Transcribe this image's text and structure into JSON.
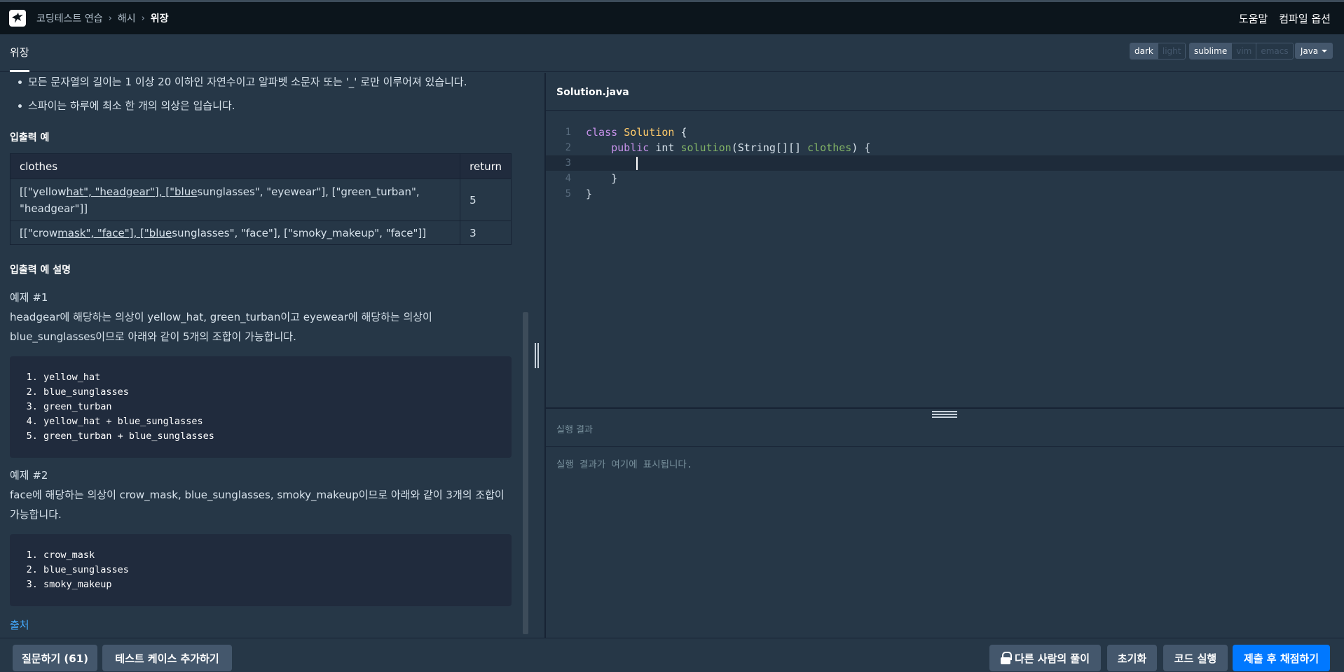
{
  "header": {
    "breadcrumbs": [
      "코딩테스트 연습",
      "해시",
      "위장"
    ],
    "help_label": "도움말",
    "compile_options_label": "컴파일 옵션"
  },
  "subbar": {
    "problem_title": "위장",
    "theme_options": [
      "dark",
      "light"
    ],
    "theme_selected": "dark",
    "keymap_options": [
      "sublime",
      "vim",
      "emacs"
    ],
    "keymap_selected": "sublime",
    "language": "Java"
  },
  "problem": {
    "constraints": [
      "모든 문자열의 길이는 1 이상 20 이하인 자연수이고 알파벳 소문자 또는 '_' 로만 이루어져 있습니다.",
      "스파이는 하루에 최소 한 개의 의상은 입습니다."
    ],
    "io_example_heading": "입출력 예",
    "table": {
      "headers": [
        "clothes",
        "return"
      ],
      "rows": [
        {
          "clothes_a": "[[\"yellow",
          "clothes_b": "hat\", \"headgear\"], [\"blue",
          "clothes_c": "sunglasses\", \"eyewear\"], [\"green_turban\", \"headgear\"]]",
          "return": "5"
        },
        {
          "clothes_a": "[[\"crow",
          "clothes_b": "mask\", \"face\"], [\"blue",
          "clothes_c": "sunglasses\", \"face\"], [\"smoky_makeup\", \"face\"]]",
          "return": "3"
        }
      ]
    },
    "io_explanation_heading": "입출력 예 설명",
    "examples": [
      {
        "label": "예제 #1",
        "text": "headgear에 해당하는 의상이 yellow_hat, green_turban이고 eyewear에 해당하는 의상이 blue_sunglasses이므로 아래와 같이 5개의 조합이 가능합니다.",
        "items": [
          "yellow_hat",
          "blue_sunglasses",
          "green_turban",
          "yellow_hat + blue_sunglasses",
          "green_turban + blue_sunglasses"
        ]
      },
      {
        "label": "예제 #2",
        "text": "face에 해당하는 의상이 crow_mask, blue_sunglasses, smoky_makeup이므로 아래와 같이 3개의 조합이 가능합니다.",
        "items": [
          "crow_mask",
          "blue_sunglasses",
          "smoky_makeup"
        ]
      }
    ],
    "source_link": "출처"
  },
  "editor": {
    "filename": "Solution.java",
    "line_numbers": [
      "1",
      "2",
      "3",
      "4",
      "5"
    ],
    "code": {
      "l1_kw": "class",
      "l1_cls": "Solution",
      "l1_rest": " {",
      "l2_kw": "public",
      "l2_type": "int",
      "l2_fn": "solution",
      "l2_args_a": "(String[][] ",
      "l2_param": "clothes",
      "l2_args_b": ") {",
      "l4": "}",
      "l5": "}"
    }
  },
  "result": {
    "heading": "실행 결과",
    "placeholder": "실행 결과가 여기에 표시됩니다."
  },
  "footer": {
    "ask_button": "질문하기 (61)",
    "add_testcase_button": "테스트 케이스 추가하기",
    "others_solution_button": "다른 사람의 풀이",
    "reset_button": "초기화",
    "run_button": "코드 실행",
    "submit_button": "제출 후 채점하기"
  },
  "colors": {
    "background": "#263747",
    "topbar": "#0c151c",
    "primary": "#0078ff",
    "button": "#44576c",
    "link": "#44aaff"
  },
  "icons": [
    "logo-icon",
    "chevron-right-icon",
    "caret-down-icon",
    "lock-icon",
    "grip-icon"
  ]
}
